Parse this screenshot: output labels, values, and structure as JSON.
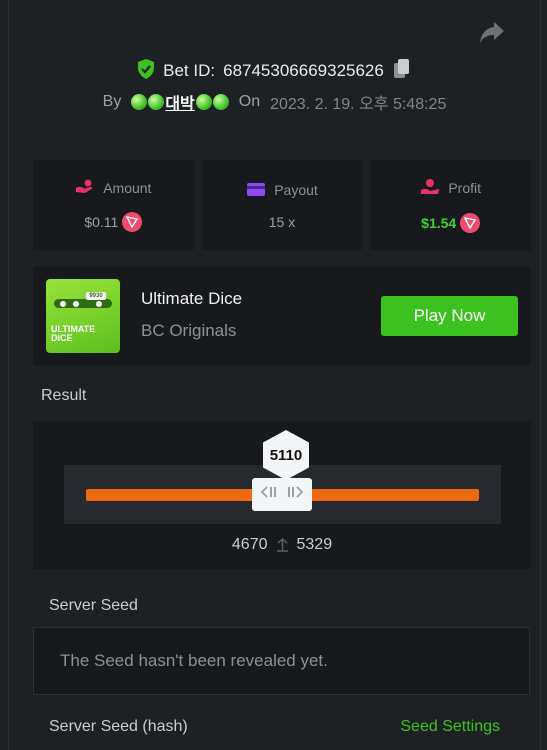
{
  "header": {
    "bet_id_label": "Bet ID:",
    "bet_id": "68745306669325626",
    "by_label": "By",
    "username": "대박",
    "on_label": "On",
    "date": "2023. 2. 19. 오후 5:48:25"
  },
  "stats": {
    "amount": {
      "label": "Amount",
      "value": "$0.11",
      "icon": "money-hand-icon"
    },
    "payout": {
      "label": "Payout",
      "value": "15 x",
      "icon": "wallet-icon"
    },
    "profit": {
      "label": "Profit",
      "value": "$1.54",
      "icon": "profit-icon"
    }
  },
  "game": {
    "title": "Ultimate Dice",
    "subtitle": "BC Originals",
    "play_label": "Play Now",
    "thumb_text": "ULTIMATE DICE",
    "thumb_pill": "9930"
  },
  "result": {
    "title": "Result",
    "roll": "5110",
    "range_low": "4670",
    "range_high": "5329"
  },
  "seed": {
    "server_seed_title": "Server Seed",
    "server_seed_text": "The Seed hasn't been revealed yet.",
    "hash_title": "Server Seed (hash)",
    "settings_label": "Seed Settings"
  },
  "colors": {
    "accent_green": "#3cc21f",
    "track_orange": "#ee6a10",
    "coin_red": "#ef4a70"
  }
}
